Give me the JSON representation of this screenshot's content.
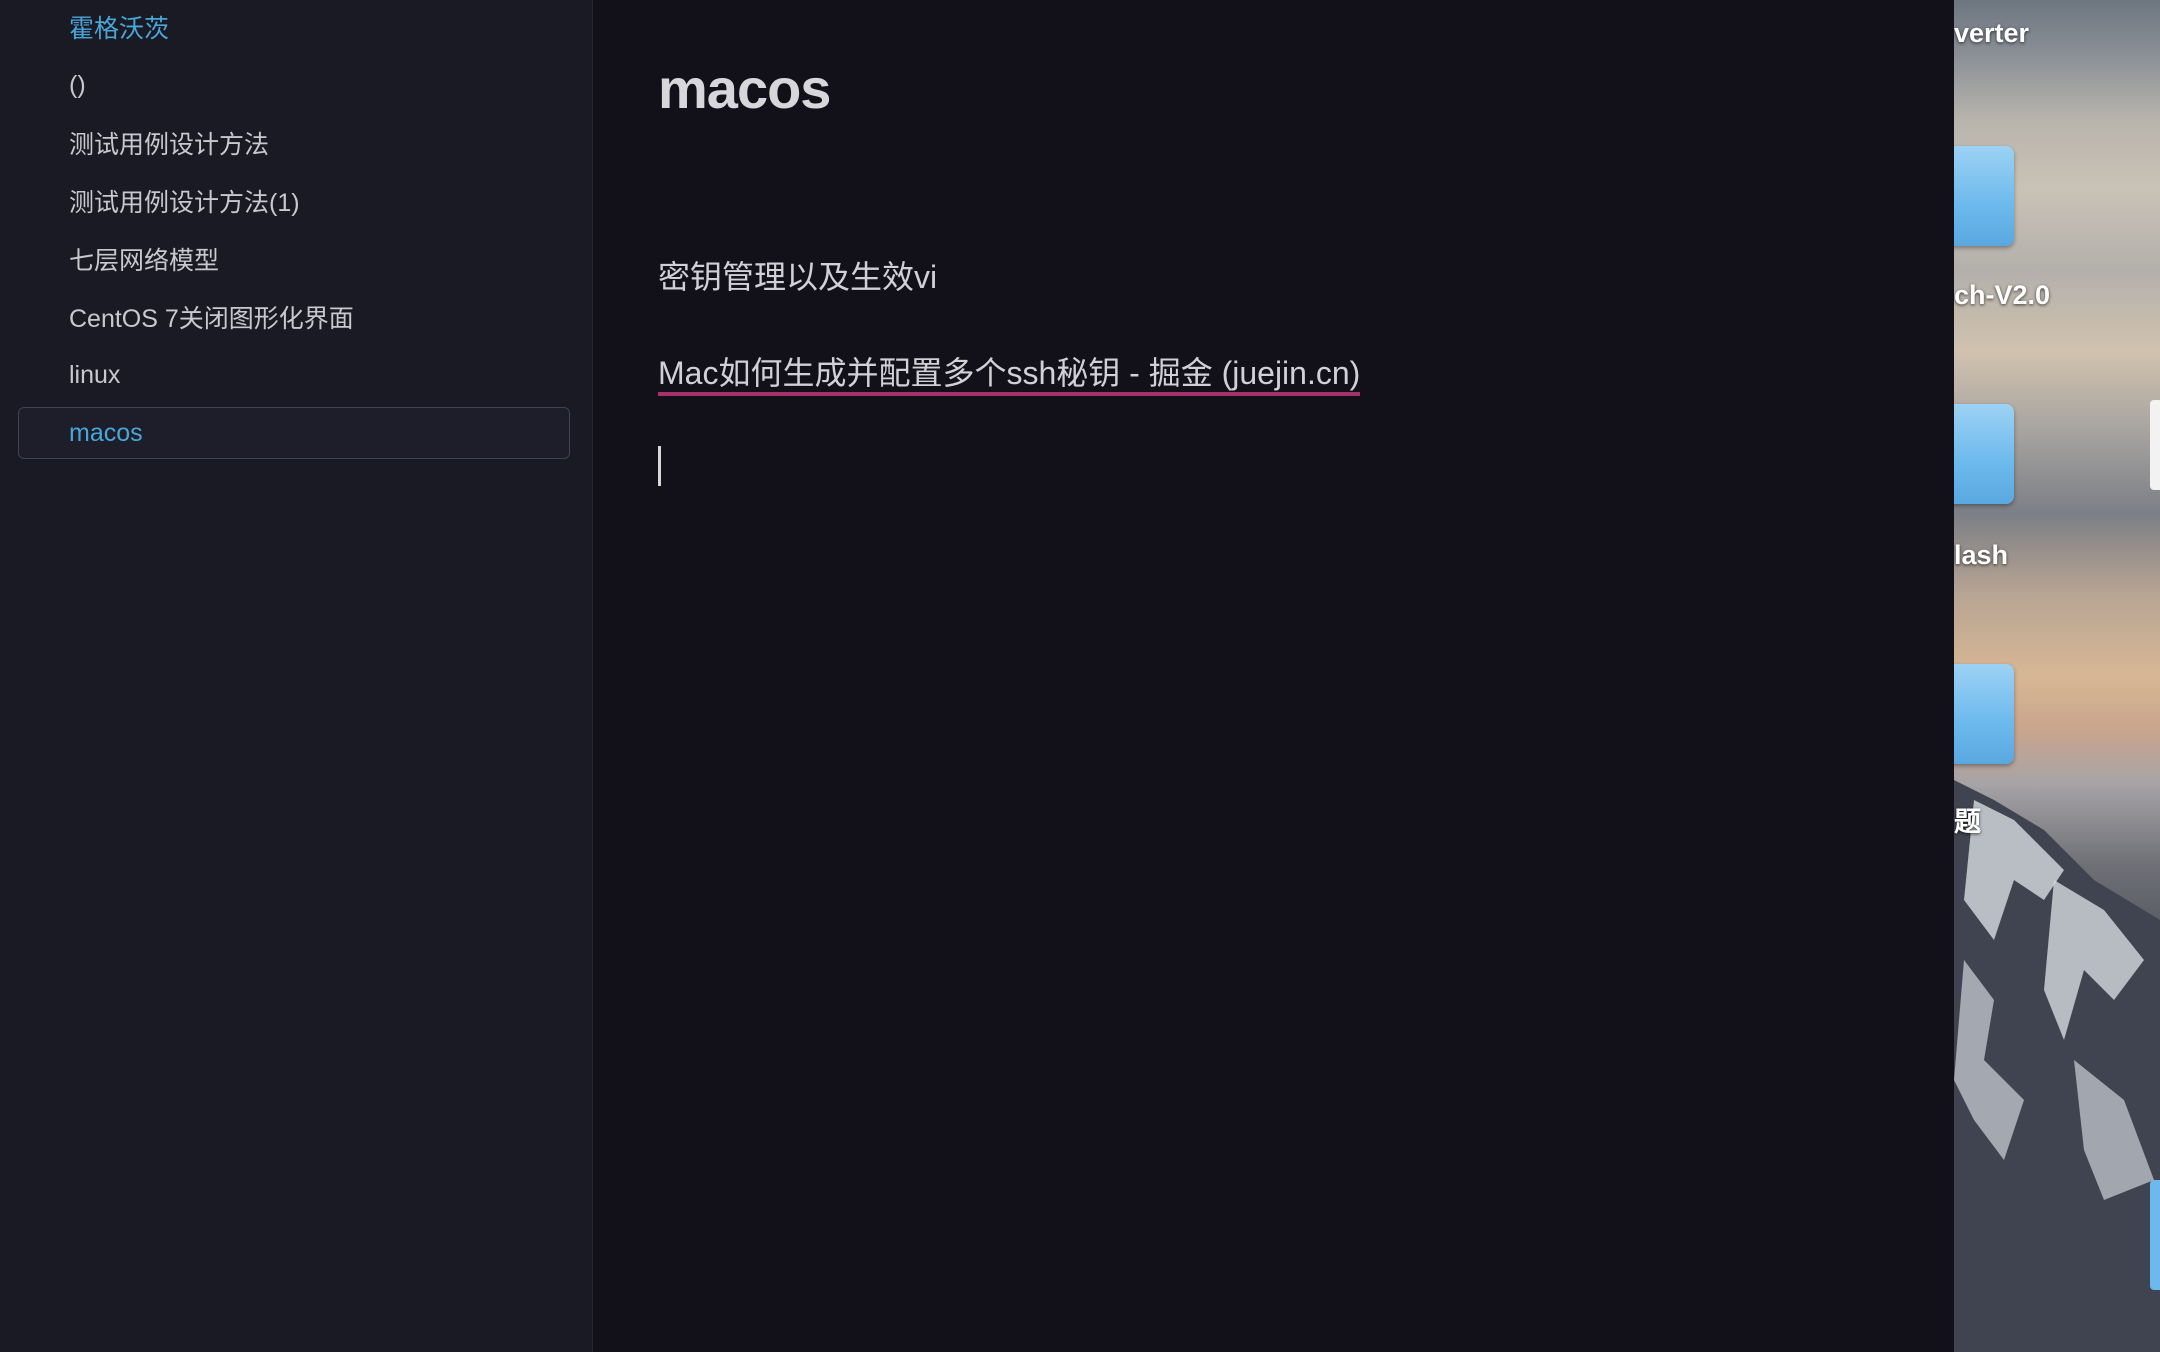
{
  "sidebar": {
    "items": [
      {
        "label": "霍格沃茨"
      },
      {
        "label": "()"
      },
      {
        "label": "测试用例设计方法"
      },
      {
        "label": "测试用例设计方法(1)"
      },
      {
        "label": "七层网络模型"
      },
      {
        "label": "CentOS 7关闭图形化界面"
      },
      {
        "label": "linux"
      },
      {
        "label": "macos"
      }
    ],
    "active_index": 7
  },
  "document": {
    "title": "macos",
    "paragraphs": [
      {
        "text": "密钥管理以及生效vi"
      },
      {
        "link_text": "Mac如何生成并配置多个ssh秘钥 - 掘金 (juejin.cn)"
      }
    ]
  },
  "desktop": {
    "labels": [
      "verter",
      "ch-V2.0",
      "lash",
      "题"
    ]
  },
  "colors": {
    "sidebar_bg": "#1a1a24",
    "editor_bg": "#12111a",
    "accent_blue": "#49a6d8",
    "link_underline": "#a5326b",
    "text": "#d0d0d5"
  }
}
